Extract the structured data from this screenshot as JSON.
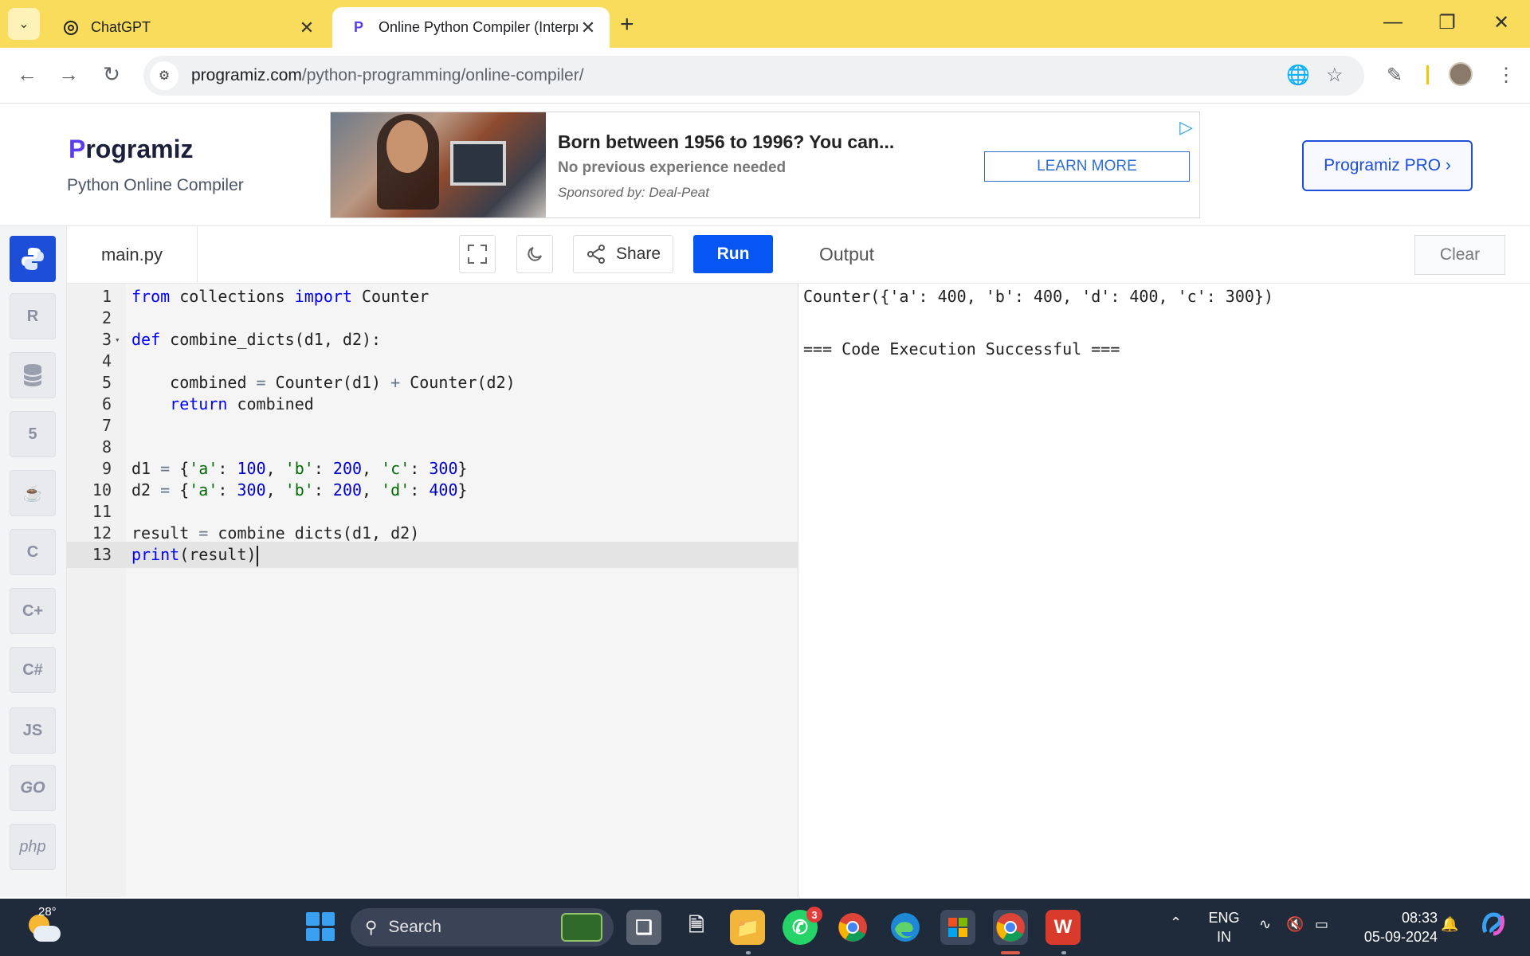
{
  "browser": {
    "tabs": [
      {
        "title": "ChatGPT",
        "favicon": "chatgpt-icon",
        "active": false
      },
      {
        "title": "Online Python Compiler (Interpr",
        "favicon": "programiz-icon",
        "active": true
      }
    ],
    "url_domain": "programiz.com",
    "url_path": "/python-programming/online-compiler/"
  },
  "site": {
    "logo_mark": "P",
    "logo_text": "rogramiz",
    "subtitle": "Python Online Compiler",
    "pro_button": "Programiz PRO ›"
  },
  "ad": {
    "title": "Born between 1956 to 1996? You can...",
    "subtitle": "No previous experience needed",
    "sponsor": "Sponsored by: Deal-Peat",
    "cta": "LEARN MORE"
  },
  "sidebar": {
    "items": [
      {
        "name": "python",
        "label": "",
        "icon": "python-icon",
        "active": true
      },
      {
        "name": "r",
        "label": "R",
        "icon": "r-icon"
      },
      {
        "name": "sql",
        "label": "",
        "icon": "database-icon"
      },
      {
        "name": "html",
        "label": "5",
        "icon": "html5-icon"
      },
      {
        "name": "java",
        "label": "",
        "icon": "java-icon"
      },
      {
        "name": "c",
        "label": "C",
        "icon": "c-icon"
      },
      {
        "name": "cpp",
        "label": "C+",
        "icon": "cpp-icon"
      },
      {
        "name": "csharp",
        "label": "C#",
        "icon": "csharp-icon"
      },
      {
        "name": "js",
        "label": "JS",
        "icon": "js-icon"
      },
      {
        "name": "go",
        "label": "GO",
        "icon": "go-icon"
      },
      {
        "name": "php",
        "label": "php",
        "icon": "php-icon"
      }
    ]
  },
  "editor": {
    "filename": "main.py",
    "share_label": "Share",
    "run_label": "Run",
    "lines": [
      {
        "n": "1",
        "code": "from collections import Counter"
      },
      {
        "n": "2",
        "code": ""
      },
      {
        "n": "3",
        "code": "def combine_dicts(d1, d2):",
        "fold": true
      },
      {
        "n": "4",
        "code": ""
      },
      {
        "n": "5",
        "code": "    combined = Counter(d1) + Counter(d2)"
      },
      {
        "n": "6",
        "code": "    return combined"
      },
      {
        "n": "7",
        "code": ""
      },
      {
        "n": "8",
        "code": ""
      },
      {
        "n": "9",
        "code": "d1 = {'a': 100, 'b': 200, 'c': 300}"
      },
      {
        "n": "10",
        "code": "d2 = {'a': 300, 'b': 200, 'd': 400}"
      },
      {
        "n": "11",
        "code": ""
      },
      {
        "n": "12",
        "code": "result = combine_dicts(d1, d2)"
      },
      {
        "n": "13",
        "code": "print(result)",
        "current": true
      }
    ]
  },
  "output": {
    "title": "Output",
    "clear_label": "Clear",
    "lines": [
      "Counter({'a': 400, 'b': 400, 'd': 400, 'c': 300})",
      "",
      "=== Code Execution Successful ==="
    ]
  },
  "taskbar": {
    "temperature": "28°",
    "search_placeholder": "Search",
    "whatsapp_badge": "3",
    "lang_top": "ENG",
    "lang_bottom": "IN",
    "time": "08:33",
    "date": "05-09-2024"
  },
  "colors": {
    "tabstrip": "#f9dc5c",
    "run_button": "#0556f3",
    "accent": "#1d4ed8",
    "taskbar": "#1f2a3a"
  }
}
